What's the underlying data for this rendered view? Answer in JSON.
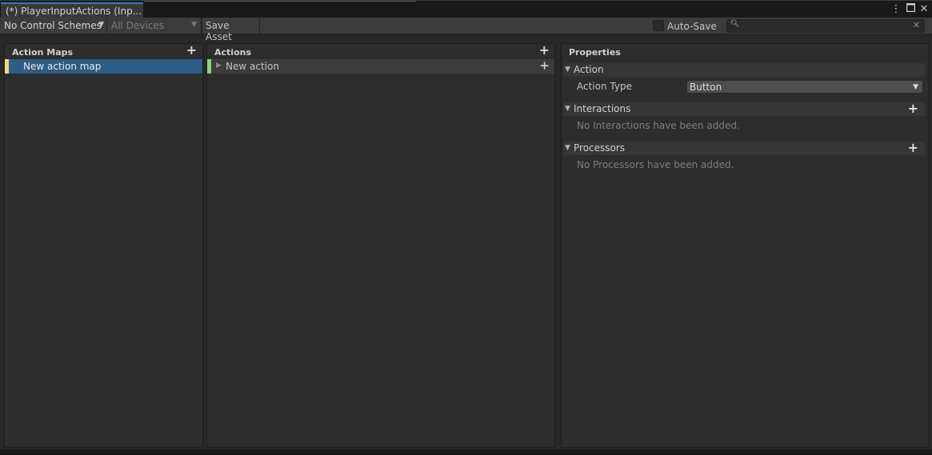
{
  "window": {
    "tab_title": "(*) PlayerInputActions (Inp...",
    "menu_icon": "kebab-menu-icon",
    "maximize_icon": "maximize-icon",
    "close_icon": "close-icon"
  },
  "toolbar": {
    "control_schemes": "No Control Schemes",
    "devices": "All Devices",
    "save_asset": "Save Asset",
    "auto_save_label": "Auto-Save",
    "auto_save_checked": false,
    "search_value": "",
    "search_icon": "search-icon",
    "clear_icon": "clear-icon"
  },
  "action_maps": {
    "header": "Action Maps",
    "items": [
      {
        "label": "New action map",
        "selected": true,
        "color": "#f3d77a"
      }
    ]
  },
  "actions": {
    "header": "Actions",
    "items": [
      {
        "label": "New action",
        "color": "#8ed185"
      }
    ]
  },
  "properties": {
    "header": "Properties",
    "action_section": {
      "title": "Action",
      "action_type_label": "Action Type",
      "action_type_value": "Button"
    },
    "interactions_section": {
      "title": "Interactions",
      "empty_text": "No Interactions have been added."
    },
    "processors_section": {
      "title": "Processors",
      "empty_text": "No Processors have been added."
    }
  },
  "colors": {
    "selection": "#2c5d87",
    "tab_accent": "#3a79bb"
  }
}
